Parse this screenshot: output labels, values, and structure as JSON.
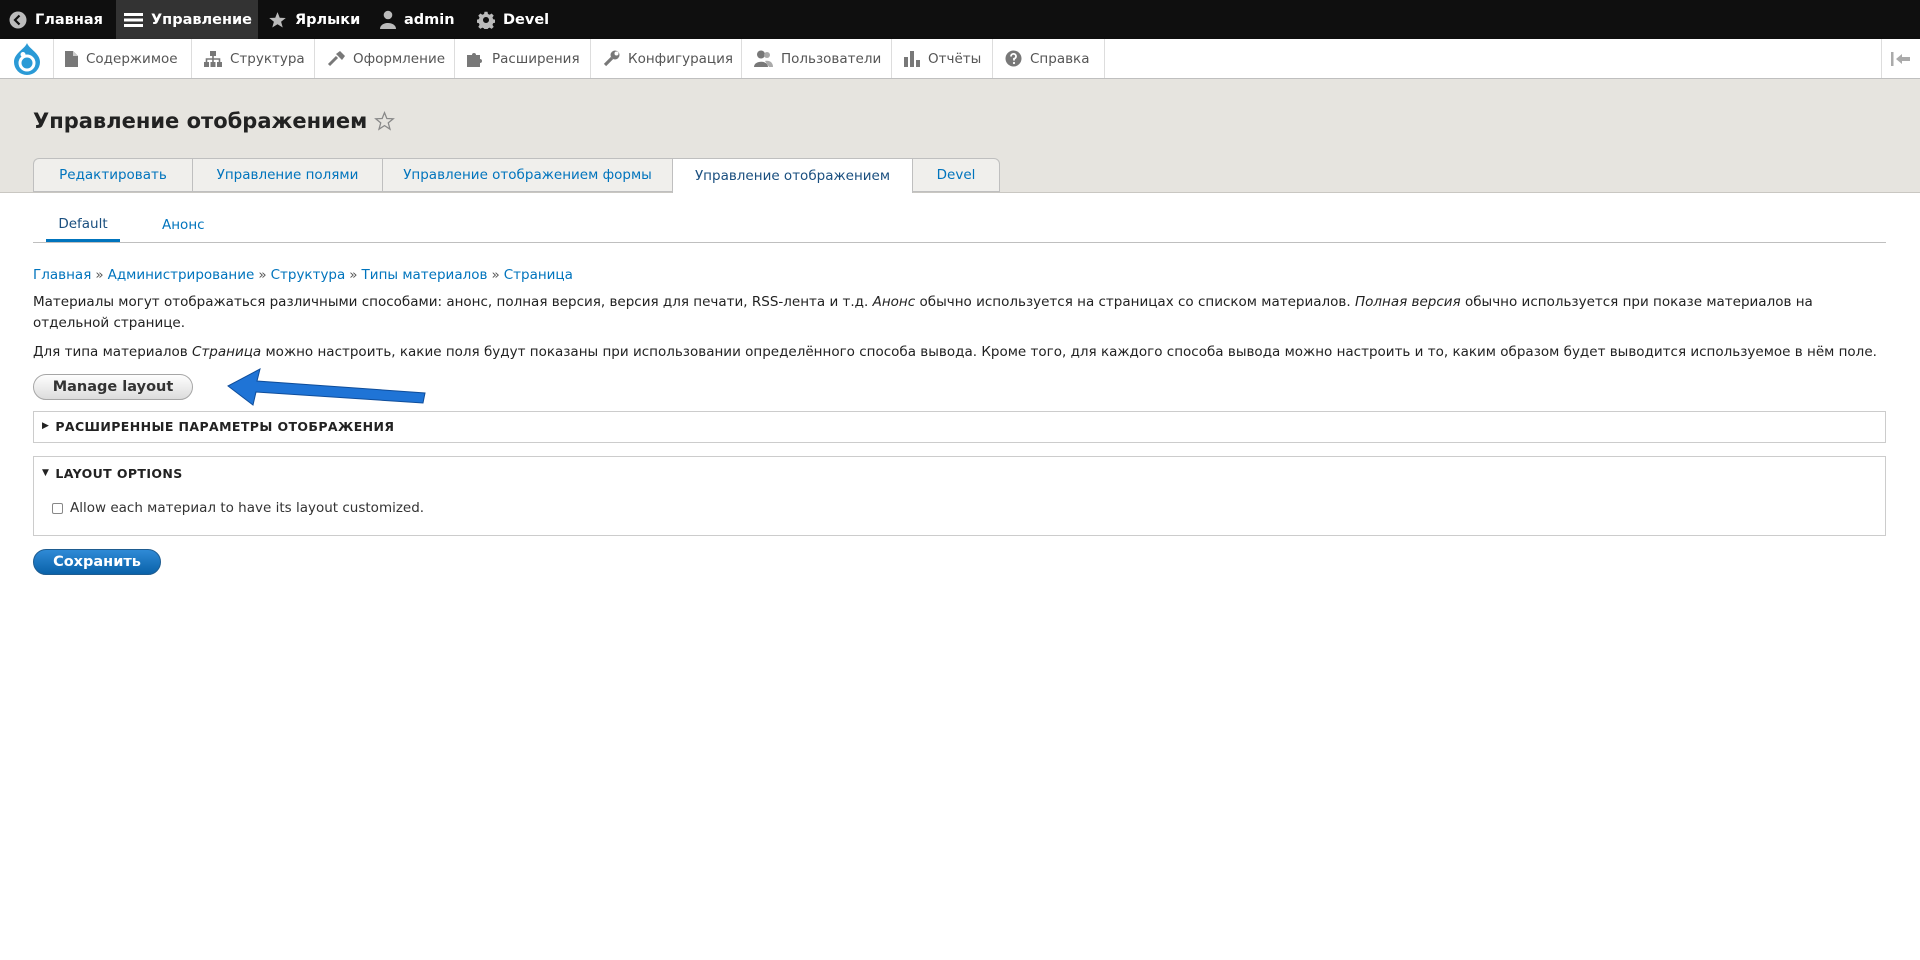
{
  "toolbar": {
    "home": "Главная",
    "manage": "Управление",
    "shortcuts": "Ярлыки",
    "user": "admin",
    "devel": "Devel"
  },
  "menu": {
    "content": "Содержимое",
    "structure": "Структура",
    "appearance": "Оформление",
    "extend": "Расширения",
    "config": "Конфигурация",
    "people": "Пользователи",
    "reports": "Отчёты",
    "help": "Справка"
  },
  "page": {
    "title": "Управление отображением"
  },
  "tabs": [
    {
      "label": "Редактировать"
    },
    {
      "label": "Управление полями"
    },
    {
      "label": "Управление отображением формы"
    },
    {
      "label": "Управление отображением"
    },
    {
      "label": "Devel"
    }
  ],
  "subtabs": [
    {
      "label": "Default"
    },
    {
      "label": "Анонс"
    }
  ],
  "breadcrumb": [
    "Главная",
    "Администрирование",
    "Структура",
    "Типы материалов",
    "Страница"
  ],
  "breadcrumb_sep": "»",
  "desc1": {
    "a": "Материалы могут отображаться различными способами: анонс, полная версия, версия для печати, RSS-лента и т.д. ",
    "b": "Анонс",
    "c": " обычно используется на страницах со списком материалов. ",
    "d": "Полная версия",
    "e": " обычно используется при показе материалов на отдельной странице."
  },
  "desc2": {
    "a": "Для типа материалов ",
    "b": "Страница",
    "c": " можно настроить, какие поля будут показаны при использовании определённого способа вывода. Кроме того, для каждого способа вывода можно настроить и то, каким образом будет выводится используемое в нём поле."
  },
  "buttons": {
    "manage_layout": "Manage layout",
    "save": "Сохранить"
  },
  "details": {
    "advanced": "РАСШИРЕННЫЕ ПАРАМЕТРЫ ОТОБРАЖЕНИЯ",
    "layout_options": "LAYOUT OPTIONS",
    "checkbox_label": "Allow each материал to have its layout customized."
  },
  "colors": {
    "link": "#0074bd",
    "arrow": "#1f74d6",
    "toolbar": "#0f0f0f"
  }
}
